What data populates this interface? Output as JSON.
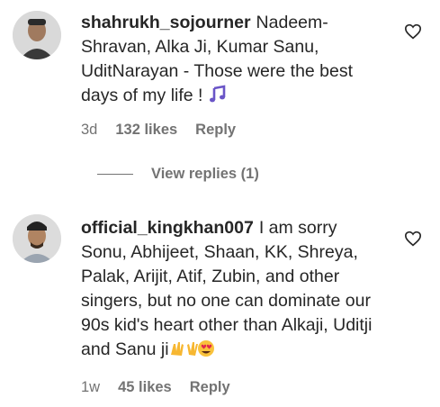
{
  "comments": [
    {
      "username": "shahrukh_sojourner",
      "text": "Nadeem-Shravan, Alka Ji, Kumar Sanu, UditNarayan - Those were the best days of my life ! ",
      "trailing_emoji": "music-notes-icon",
      "age": "3d",
      "likes": "132 likes",
      "reply_label": "Reply",
      "view_replies": "View replies (1)"
    },
    {
      "username": "official_kingkhan007",
      "text": "I am sorry Sonu, Abhijeet, Shaan, KK, Shreya, Palak, Arijit, Atif, Zubin, and other singers, but no one can dominate our 90s kid's heart other than Alkaji, Uditji and Sanu ji",
      "trailing_emoji": "raised-hands-and-heart-eyes-emoji",
      "age": "1w",
      "likes": "45 likes",
      "reply_label": "Reply"
    }
  ]
}
